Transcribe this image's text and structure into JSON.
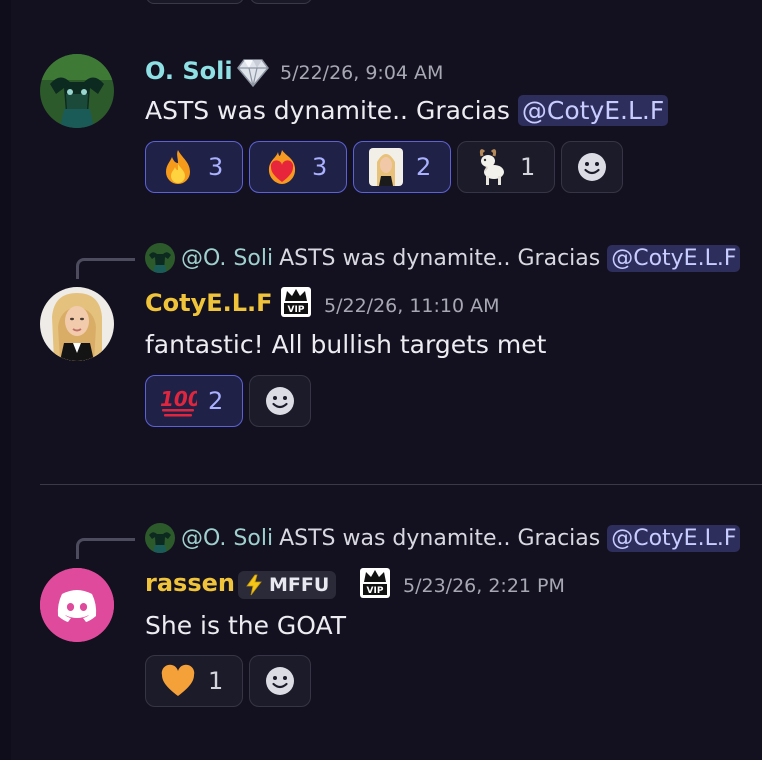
{
  "colors": {
    "background": "#13111f",
    "soli_name": "#8fe0e5",
    "coty_name": "#f0c43a",
    "rassen_name": "#f0c43a",
    "mention_bg": "#2d2e5c",
    "reaction_me_border": "#5b61d6"
  },
  "messages": [
    {
      "username": "O. Soli",
      "badge_icon": "diamond-icon",
      "timestamp": "5/22/26, 9:04 AM",
      "text_before": "ASTS was dynamite.. Gracias ",
      "mention": "@CotyE.L.F",
      "reactions": [
        {
          "emoji": "fire-icon",
          "count": "3",
          "me": true
        },
        {
          "emoji": "heart-on-fire-icon",
          "count": "3",
          "me": true
        },
        {
          "emoji": "coty-custom-emoji",
          "count": "2",
          "me": true
        },
        {
          "emoji": "goat-icon",
          "count": "1",
          "me": false
        }
      ]
    },
    {
      "reply": {
        "name": "@O. Soli",
        "text_before": "ASTS was dynamite.. Gracias ",
        "mention": "@CotyE.L.F"
      },
      "username": "CotyE.L.F",
      "badge_icon": "vip-crown-icon",
      "timestamp": "5/22/26, 11:10 AM",
      "text": "fantastic!  All bullish targets met",
      "reactions": [
        {
          "emoji": "hundred-points-icon",
          "count": "2",
          "me": true
        }
      ]
    },
    {
      "reply": {
        "name": "@O. Soli",
        "text_before": "ASTS was dynamite.. Gracias ",
        "mention": "@CotyE.L.F"
      },
      "username": "rassen",
      "role_tag": "MFFU",
      "badge_icon": "vip-crown-icon",
      "timestamp": "5/23/26, 2:21 PM",
      "text": "She is the GOAT",
      "reactions": [
        {
          "emoji": "orange-heart-icon",
          "count": "1",
          "me": false
        }
      ]
    }
  ]
}
